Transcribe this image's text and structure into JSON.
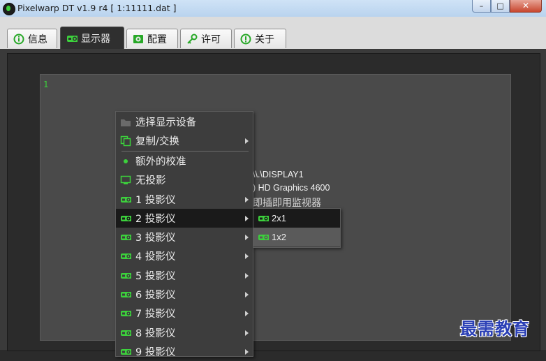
{
  "window": {
    "title": "Pixelwarp DT v1.9 r4 [ 1:11111.dat ]",
    "controls": {
      "minimize": "–",
      "maximize": "□",
      "close": "✕"
    }
  },
  "tabs": [
    {
      "label": "信息",
      "icon": "info-circle-icon"
    },
    {
      "label": "显示器",
      "icon": "projector-icon",
      "active": true
    },
    {
      "label": "配置",
      "icon": "config-icon"
    },
    {
      "label": "许可",
      "icon": "key-icon"
    },
    {
      "label": "关于",
      "icon": "exclamation-circle-icon"
    }
  ],
  "display": {
    "number": "1",
    "name": "\\\\.\\DISPLAY1",
    "adapter": ") HD Graphics 4600",
    "monitor": "即插即用监视器"
  },
  "menu": {
    "items": [
      {
        "label": "选择显示设备",
        "icon": "folder-icon"
      },
      {
        "label": "复制/交换",
        "icon": "copy-icon",
        "submenu": true
      },
      {
        "label": "额外的校准",
        "icon": "dot-icon"
      },
      {
        "label": "无投影",
        "icon": "monitor-icon"
      },
      {
        "label": "1 投影仪",
        "icon": "projector-icon",
        "submenu": true
      },
      {
        "label": "2 投影仪",
        "icon": "projector-icon",
        "submenu": true,
        "highlighted": true
      },
      {
        "label": "3 投影仪",
        "icon": "projector-icon",
        "submenu": true
      },
      {
        "label": "4 投影仪",
        "icon": "projector-icon",
        "submenu": true
      },
      {
        "label": "5 投影仪",
        "icon": "projector-icon",
        "submenu": true
      },
      {
        "label": "6 投影仪",
        "icon": "projector-icon",
        "submenu": true
      },
      {
        "label": "7 投影仪",
        "icon": "projector-icon",
        "submenu": true
      },
      {
        "label": "8 投影仪",
        "icon": "projector-icon",
        "submenu": true
      },
      {
        "label": "9 投影仪",
        "icon": "projector-icon",
        "submenu": true
      }
    ]
  },
  "submenu": {
    "items": [
      {
        "label": "2x1",
        "icon": "projector-icon"
      },
      {
        "label": "1x2",
        "icon": "projector-icon"
      }
    ]
  },
  "watermark": "最需教育",
  "colors": {
    "accent": "#3cd13c",
    "menu_bg": "#3d3d3d",
    "highlight": "#1a1a1a"
  }
}
